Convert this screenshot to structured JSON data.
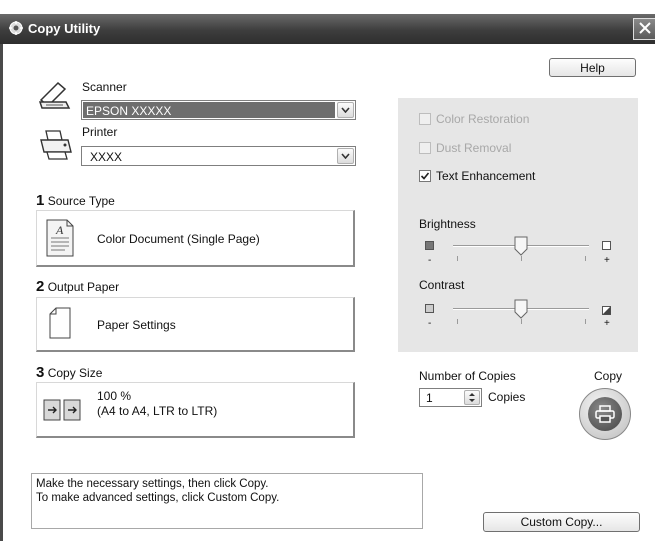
{
  "window": {
    "title": "Copy Utility",
    "close_icon": "close-icon",
    "app_icon": "copy-utility-icon"
  },
  "help_button": "Help",
  "scanner": {
    "label": "Scanner",
    "value": "EPSON XXXXX",
    "icon": "scanner-icon"
  },
  "printer": {
    "label": "Printer",
    "value": "XXXX",
    "icon": "printer-icon"
  },
  "source_type": {
    "number": "1",
    "label": "Source Type",
    "value": "Color Document (Single Page)",
    "icon": "document-icon"
  },
  "output_paper": {
    "number": "2",
    "label": "Output Paper",
    "value": "Paper Settings",
    "icon": "paper-icon"
  },
  "copy_size": {
    "number": "3",
    "label": "Copy Size",
    "line1": "100 %",
    "line2": "(A4 to A4, LTR to LTR)",
    "icon": "copy-size-icon"
  },
  "options": {
    "color_restoration": {
      "label": "Color Restoration",
      "checked": false,
      "enabled": false
    },
    "dust_removal": {
      "label": "Dust Removal",
      "checked": false,
      "enabled": false
    },
    "text_enhancement": {
      "label": "Text Enhancement",
      "checked": true,
      "enabled": true
    }
  },
  "brightness": {
    "label": "Brightness",
    "minus": "-",
    "plus": "+",
    "level": 0.5
  },
  "contrast": {
    "label": "Contrast",
    "minus": "-",
    "plus": "+",
    "level": 0.5
  },
  "copies": {
    "label": "Number of Copies",
    "value": "1",
    "unit": "Copies"
  },
  "copy_button": {
    "label": "Copy",
    "icon": "printer-copy-icon"
  },
  "message": {
    "line1": "Make the necessary settings, then click Copy.",
    "line2": "To make advanced settings, click Custom Copy."
  },
  "custom_copy_button": "Custom Copy..."
}
